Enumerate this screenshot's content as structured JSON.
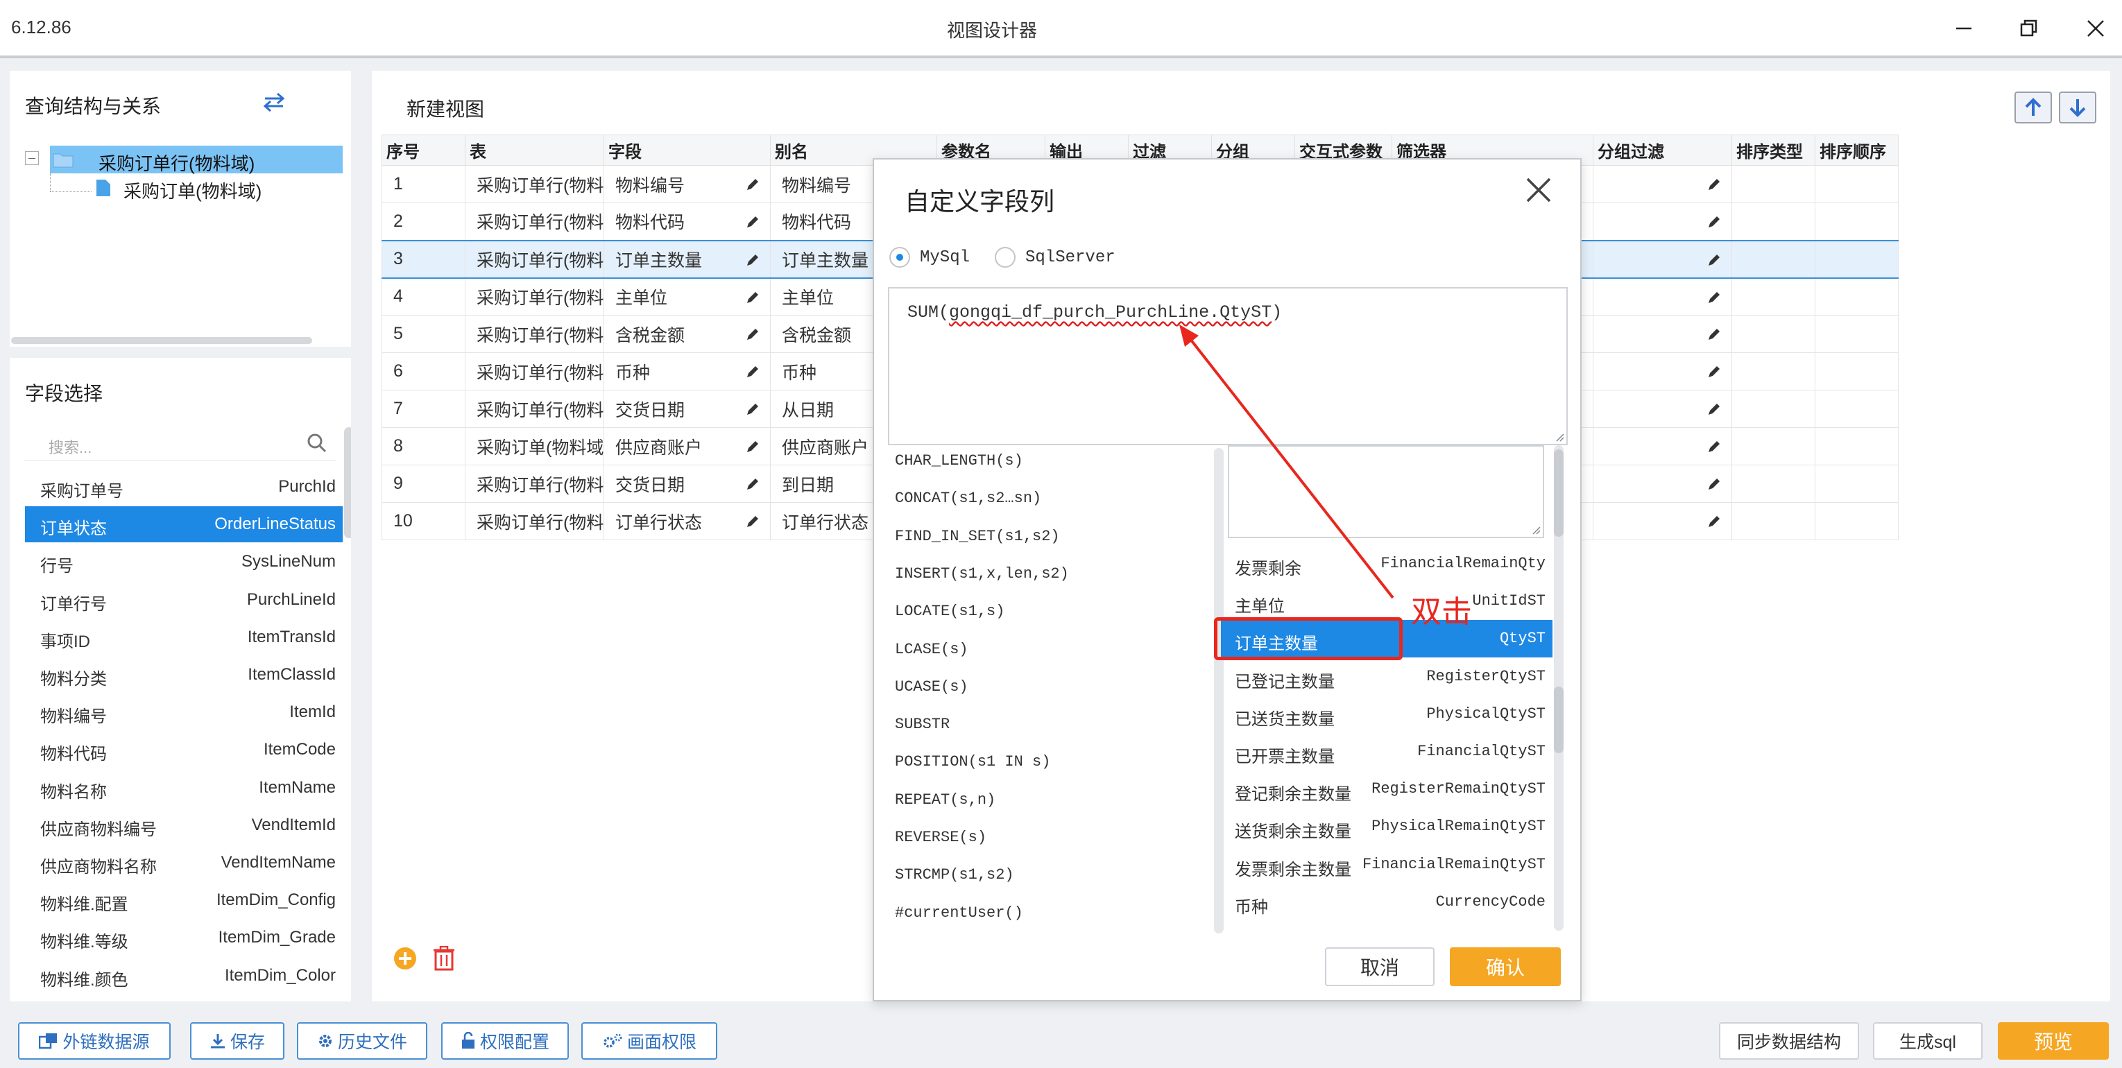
{
  "window": {
    "version": "6.12.86",
    "title": "视图设计器"
  },
  "query_panel": {
    "title": "查询结构与关系",
    "tree_root": "采购订单行(物料域)",
    "tree_child": "采购订单(物料域)"
  },
  "field_panel": {
    "title": "字段选择",
    "search_placeholder": "搜索...",
    "items": [
      {
        "cn": "采购订单号",
        "en": "PurchId"
      },
      {
        "cn": "订单状态",
        "en": "OrderLineStatus"
      },
      {
        "cn": "行号",
        "en": "SysLineNum"
      },
      {
        "cn": "订单行号",
        "en": "PurchLineId"
      },
      {
        "cn": "事项ID",
        "en": "ItemTransId"
      },
      {
        "cn": "物料分类",
        "en": "ItemClassId"
      },
      {
        "cn": "物料编号",
        "en": "ItemId"
      },
      {
        "cn": "物料代码",
        "en": "ItemCode"
      },
      {
        "cn": "物料名称",
        "en": "ItemName"
      },
      {
        "cn": "供应商物料编号",
        "en": "VendItemId"
      },
      {
        "cn": "供应商物料名称",
        "en": "VendItemName"
      },
      {
        "cn": "物料维.配置",
        "en": "ItemDim_Config"
      },
      {
        "cn": "物料维.等级",
        "en": "ItemDim_Grade"
      },
      {
        "cn": "物料维.颜色",
        "en": "ItemDim_Color"
      }
    ]
  },
  "main": {
    "title": "新建视图",
    "columns": [
      "序号",
      "表",
      "字段",
      "别名",
      "参数名",
      "输出",
      "过滤",
      "分组",
      "交互式参数",
      "筛选器",
      "分组过滤",
      "排序类型",
      "排序顺序"
    ],
    "rows": [
      {
        "no": "1",
        "table": "采购订单行(物料域)",
        "field": "物料编号",
        "alias": "物料编号"
      },
      {
        "no": "2",
        "table": "采购订单行(物料域)",
        "field": "物料代码",
        "alias": "物料代码"
      },
      {
        "no": "3",
        "table": "采购订单行(物料域)",
        "field": "订单主数量",
        "alias": "订单主数量"
      },
      {
        "no": "4",
        "table": "采购订单行(物料域)",
        "field": "主单位",
        "alias": "主单位"
      },
      {
        "no": "5",
        "table": "采购订单行(物料域)",
        "field": "含税金额",
        "alias": "含税金额"
      },
      {
        "no": "6",
        "table": "采购订单行(物料域)",
        "field": "币种",
        "alias": "币种"
      },
      {
        "no": "7",
        "table": "采购订单行(物料域)",
        "field": "交货日期",
        "alias": "从日期"
      },
      {
        "no": "8",
        "table": "采购订单(物料域)",
        "field": "供应商账户",
        "alias": "供应商账户"
      },
      {
        "no": "9",
        "table": "采购订单行(物料域)",
        "field": "交货日期",
        "alias": "到日期"
      },
      {
        "no": "10",
        "table": "采购订单行(物料域)",
        "field": "订单行状态",
        "alias": "订单行状态"
      }
    ]
  },
  "toolbar": {
    "ext_source": "外链数据源",
    "save": "保存",
    "history": "历史文件",
    "permission": "权限配置",
    "screen_permission": "画面权限",
    "sync": "同步数据结构",
    "gen_sql": "生成sql",
    "preview": "预览"
  },
  "modal": {
    "title": "自定义字段列",
    "db_options": [
      "MySql",
      "SqlServer"
    ],
    "selected_db": "MySql",
    "expression_prefix": "SUM(",
    "expression_body": "gongqi_df_purch_PurchLine.QtyST",
    "expression_suffix": ")",
    "functions": [
      "CHAR_LENGTH(s)",
      "CONCAT(s1,s2…sn)",
      "FIND_IN_SET(s1,s2)",
      "INSERT(s1,x,len,s2)",
      "LOCATE(s1,s)",
      "LCASE(s)",
      "UCASE(s)",
      "SUBSTR",
      "POSITION(s1 IN s)",
      "REPEAT(s,n)",
      "REVERSE(s)",
      "STRCMP(s1,s2)",
      "#currentUser()"
    ],
    "columns": [
      {
        "cn": "发票剩余",
        "en": "FinancialRemainQty"
      },
      {
        "cn": "主单位",
        "en": "UnitIdST"
      },
      {
        "cn": "订单主数量",
        "en": "QtyST"
      },
      {
        "cn": "已登记主数量",
        "en": "RegisterQtyST"
      },
      {
        "cn": "已送货主数量",
        "en": "PhysicalQtyST"
      },
      {
        "cn": "已开票主数量",
        "en": "FinancialQtyST"
      },
      {
        "cn": "登记剩余主数量",
        "en": "RegisterRemainQtyST"
      },
      {
        "cn": "送货剩余主数量",
        "en": "PhysicalRemainQtyST"
      },
      {
        "cn": "发票剩余主数量",
        "en": "FinancialRemainQtyST"
      },
      {
        "cn": "币种",
        "en": "CurrencyCode"
      }
    ],
    "selected_column": "订单主数量",
    "cancel": "取消",
    "confirm": "确认"
  },
  "annotation": {
    "text": "双击"
  },
  "colors": {
    "accent": "#1e88e5",
    "orange": "#f5a623",
    "annotation": "#e8271d",
    "tree_highlight": "#7cc3f5"
  }
}
